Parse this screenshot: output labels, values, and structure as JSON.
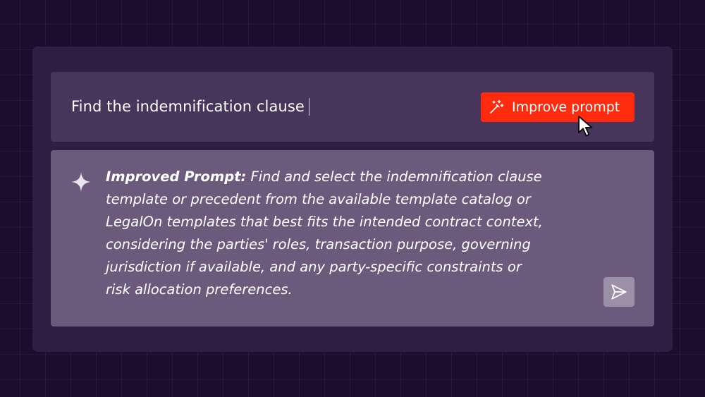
{
  "prompt": {
    "text": "Find the indemnification clause"
  },
  "improve_button": {
    "label": "Improve prompt",
    "icon": "magic-wand-icon"
  },
  "improved": {
    "label": "Improved Prompt:",
    "text": " Find and select the indemnification clause\ntemplate or precedent from the available template catalog or\nLegalOn templates that best fits the intended contract context,\nconsidering the parties' roles, transaction purpose, governing\njurisdiction if available, and any party-specific constraints or\nrisk allocation preferences.",
    "icon": "sparkle-icon"
  },
  "send_button": {
    "icon": "send-icon"
  },
  "colors": {
    "background": "#1e0c2e",
    "panel": "#2f1e41",
    "prompt_bar": "#48355c",
    "improved_card": "#6b5a7b",
    "accent": "#ff2b0f",
    "send_button": "#9c8fa8"
  }
}
